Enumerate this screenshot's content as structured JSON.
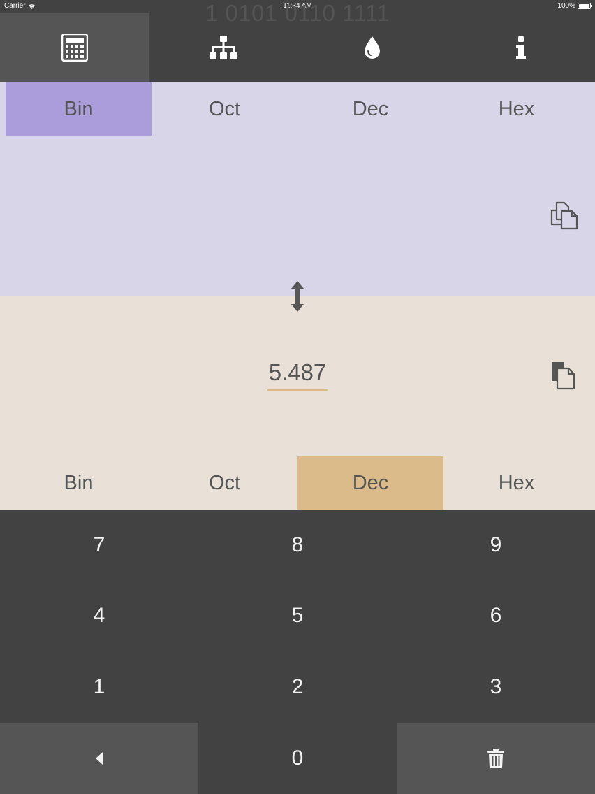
{
  "status_bar": {
    "carrier": "Carrier",
    "time": "11:34 AM",
    "battery": "100%"
  },
  "tabs": [
    {
      "icon": "calculator-icon",
      "active": true
    },
    {
      "icon": "hierarchy-icon",
      "active": false
    },
    {
      "icon": "droplet-icon",
      "active": false
    },
    {
      "icon": "info-icon",
      "active": false
    }
  ],
  "source": {
    "bases": [
      "Bin",
      "Oct",
      "Dec",
      "Hex"
    ],
    "selected": "Bin",
    "value": "1 0101 0110 1111",
    "accent": "#ab9ddb",
    "background": "#d9d5e8"
  },
  "target": {
    "bases": [
      "Bin",
      "Oct",
      "Dec",
      "Hex"
    ],
    "selected": "Dec",
    "value": "5.487",
    "accent": "#dbbb8a",
    "background": "#e9e1d7"
  },
  "keypad": {
    "keys": [
      "7",
      "8",
      "9",
      "4",
      "5",
      "6",
      "1",
      "2",
      "3",
      "0"
    ],
    "backspace_icon": "backspace-icon",
    "clear_icon": "trash-icon"
  }
}
